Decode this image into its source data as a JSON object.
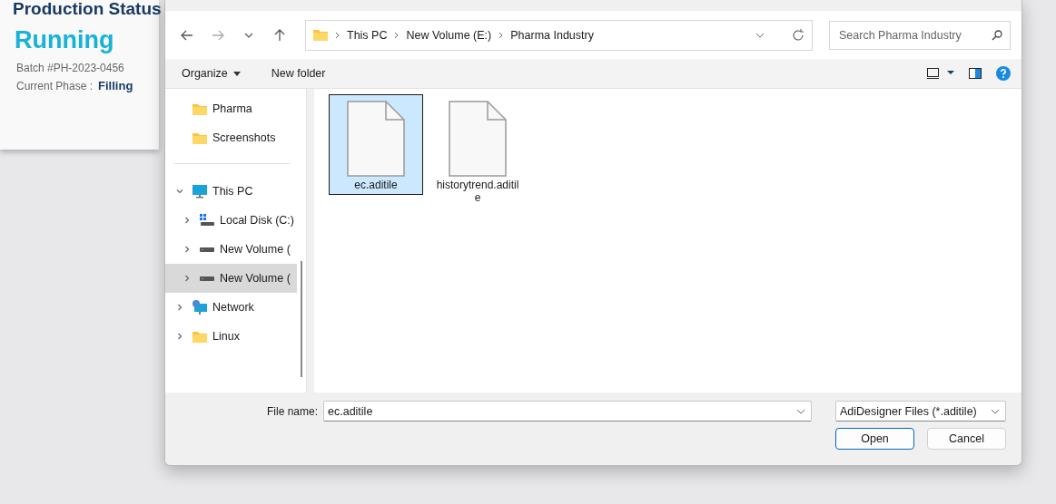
{
  "status_card": {
    "title": "Production Status",
    "state": "Running",
    "batch": "Batch #PH-2023-0456",
    "phase_label": "Current Phase :",
    "phase": "Filling"
  },
  "dialog": {
    "breadcrumb": [
      "This PC",
      "New Volume (E:)",
      "Pharma Industry"
    ],
    "search": {
      "placeholder": "Search Pharma Industry"
    },
    "toolbar": {
      "organize": "Organize",
      "new_folder": "New folder"
    },
    "nav": [
      {
        "label": "Pharma",
        "kind": "folder",
        "selected": false
      },
      {
        "label": "Screenshots",
        "kind": "folder",
        "selected": false
      },
      {
        "label": "This PC",
        "kind": "computer",
        "selected": false,
        "expanded": true,
        "children": [
          {
            "label": "Local Disk (C:)",
            "kind": "system-drive",
            "selected": false,
            "expanded": false
          },
          {
            "label": "New Volume (",
            "kind": "drive",
            "selected": false,
            "expanded": false
          },
          {
            "label": "New Volume (",
            "kind": "drive",
            "selected": true,
            "expanded": false
          }
        ]
      },
      {
        "label": "Network",
        "kind": "network",
        "selected": false,
        "expanded": false
      },
      {
        "label": "Linux",
        "kind": "folder",
        "selected": false,
        "expanded": false
      }
    ],
    "files": [
      {
        "name": "ec.aditile",
        "selected": true
      },
      {
        "name": "historytrend.aditile",
        "selected": false
      }
    ],
    "file_name_label": "File name:",
    "file_name": "ec.aditile",
    "file_type": "AdiDesigner Files (*.aditile)",
    "buttons": [
      {
        "label": "Open",
        "kind": "primary"
      },
      {
        "label": "Cancel",
        "kind": "secondary"
      }
    ]
  }
}
